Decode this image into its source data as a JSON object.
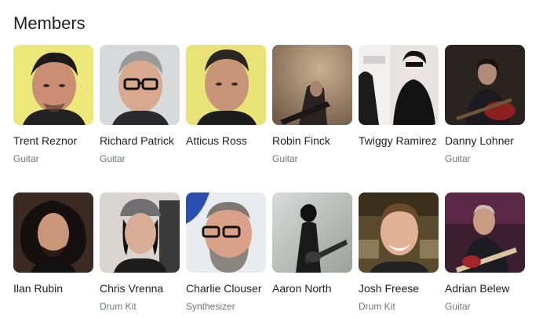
{
  "section": {
    "title": "Members"
  },
  "members": [
    {
      "name": "Trent Reznor",
      "role": "Guitar",
      "photo": "trent-reznor-photo",
      "bg": "#ece87a"
    },
    {
      "name": "Richard Patrick",
      "role": "Guitar",
      "photo": "richard-patrick-photo",
      "bg": "#d8d9db"
    },
    {
      "name": "Atticus Ross",
      "role": "",
      "photo": "atticus-ross-photo",
      "bg": "#e9e377"
    },
    {
      "name": "Robin Finck",
      "role": "Guitar",
      "photo": "robin-finck-photo",
      "bg": "#8c7660"
    },
    {
      "name": "Twiggy Ramirez",
      "role": "",
      "photo": "twiggy-ramirez-photo",
      "bg": "#e6e3e0"
    },
    {
      "name": "Danny Lohner",
      "role": "Guitar",
      "photo": "danny-lohner-photo",
      "bg": "#2a2320"
    },
    {
      "name": "Ilan Rubin",
      "role": "",
      "photo": "ilan-rubin-photo",
      "bg": "#3a2a22"
    },
    {
      "name": "Chris Vrenna",
      "role": "Drum Kit",
      "photo": "chris-vrenna-photo",
      "bg": "#d9d4cf"
    },
    {
      "name": "Charlie Clouser",
      "role": "Synthesizer",
      "photo": "charlie-clouser-photo",
      "bg": "#e8ebf0"
    },
    {
      "name": "Aaron North",
      "role": "",
      "photo": "aaron-north-photo",
      "bg": "#c5c8c4"
    },
    {
      "name": "Josh Freese",
      "role": "Drum Kit",
      "photo": "josh-freese-photo",
      "bg": "#5a4a2e"
    },
    {
      "name": "Adrian Belew",
      "role": "Guitar",
      "photo": "adrian-belew-photo",
      "bg": "#3b1f2f"
    }
  ]
}
